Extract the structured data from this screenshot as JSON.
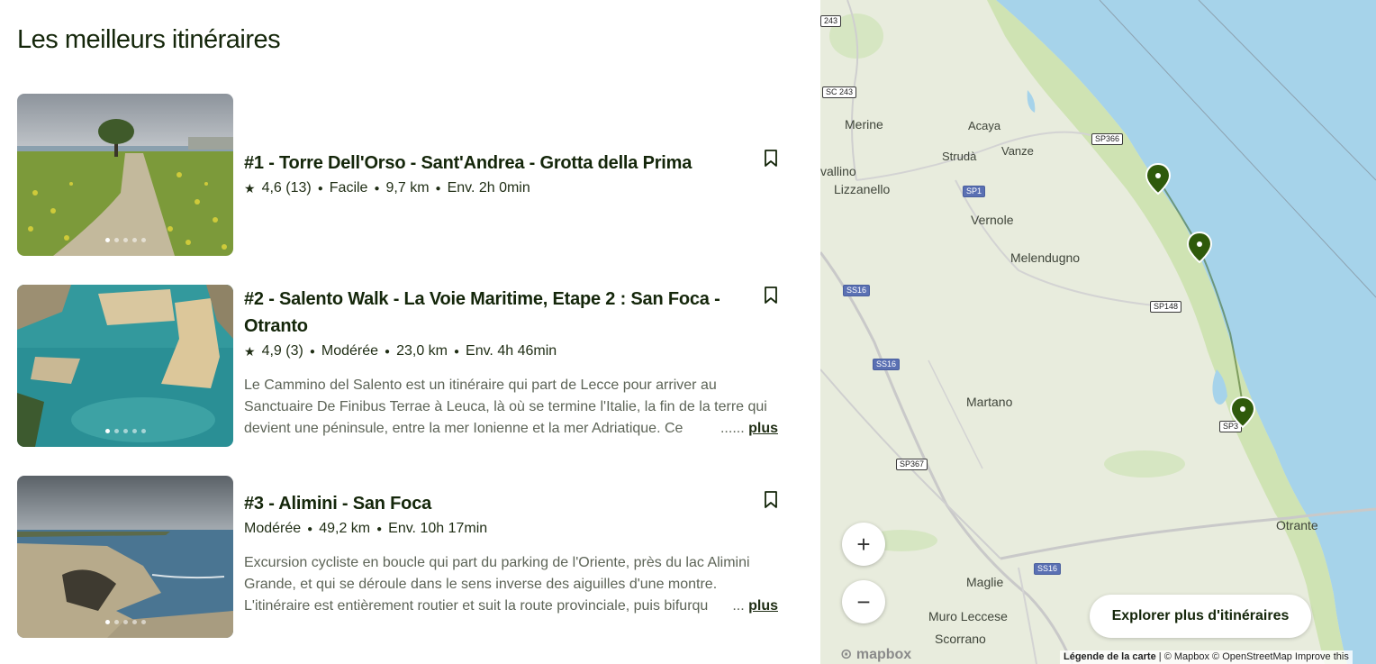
{
  "page": {
    "title": "Les meilleurs itinéraires"
  },
  "routes": [
    {
      "title": "#1 - Torre Dell'Orso - Sant'Andrea - Grotta della Prima",
      "rating": "4,6",
      "reviews": "(13)",
      "difficulty": "Facile",
      "distance": "9,7 km",
      "duration": "Env. 2h 0min",
      "description": "",
      "more": ""
    },
    {
      "title": "#2 - Salento Walk - La Voie Maritime, Etape 2 : San Foca - Otranto",
      "rating": "4,9",
      "reviews": "(3)",
      "difficulty": "Modérée",
      "distance": "23,0 km",
      "duration": "Env. 4h 46min",
      "description": "Le Cammino del Salento est un itinéraire qui part de Lecce pour arriver au Sanctuaire De Finibus Terrae à Leuca, là où se termine l'Italie, la fin de la terre qui devient une péninsule, entre la mer Ionienne et la mer Adriatique. Ce",
      "ellipsis": "...",
      "more": "plus"
    },
    {
      "title": "#3 - Alimini - San Foca",
      "rating": "",
      "reviews": "",
      "difficulty": "Modérée",
      "distance": "49,2 km",
      "duration": "Env. 10h 17min",
      "description": "Excursion cycliste en boucle qui part du parking de l'Oriente, près du lac Alimini Grande, et qui se déroule dans le sens inverse des aiguilles d'une montre. L'itinéraire est entièrement routier et suit la route provinciale, puis bifurqu",
      "ellipsis": "...",
      "more": "plus"
    }
  ],
  "icons": {
    "star": "star-icon",
    "bookmark": "bookmark-icon",
    "zoom_in": "plus-icon",
    "zoom_out": "minus-icon",
    "marker": "map-pin-icon"
  },
  "map": {
    "places": [
      "Merine",
      "Acaya",
      "Strudà",
      "Vanze",
      "vallino",
      "Lizzanello",
      "Vernole",
      "Melendugno",
      "Martano",
      "Otrante",
      "Maglie",
      "Muro Leccese",
      "Scorrano"
    ],
    "roads": [
      "243",
      "SC 243",
      "SP366",
      "SP1",
      "SS16",
      "SS16",
      "SP148",
      "SP3",
      "SP367",
      "SS16"
    ],
    "zoom_in": "+",
    "zoom_out": "−",
    "explore_button": "Explorer plus d'itinéraires",
    "attribution_legend": "Légende de la carte",
    "attribution_rest": " | © Mapbox © OpenStreetMap  Improve this",
    "logo": "mapbox"
  },
  "colors": {
    "accent": "#2f5a0b",
    "water": "#a6d3ea",
    "land": "#e8ecdd",
    "coast": "#cfe3b3"
  }
}
